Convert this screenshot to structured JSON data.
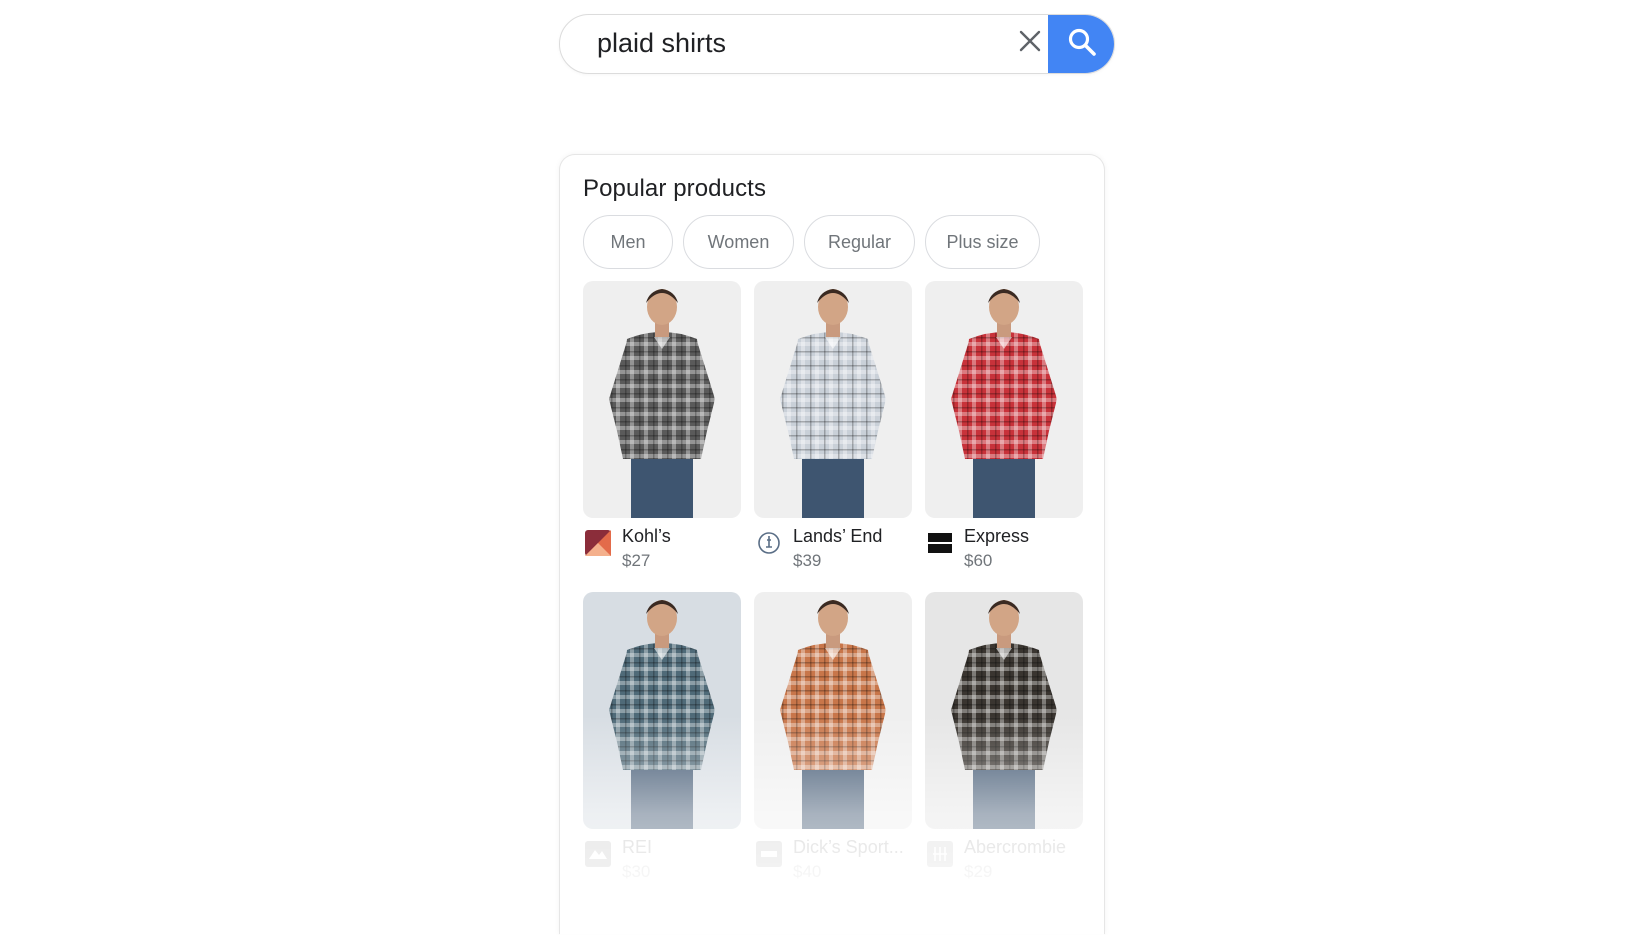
{
  "search": {
    "query": "plaid shirts"
  },
  "popular": {
    "title": "Popular products",
    "filters": [
      "Men",
      "Women",
      "Regular",
      "Plus size"
    ],
    "products": [
      {
        "merchant": "Kohl’s",
        "price": "$27",
        "logo": "kohls-logo-icon",
        "shirt": "#5a5a5a",
        "bg": "#efefef"
      },
      {
        "merchant": "Lands’ End",
        "price": "$39",
        "logo": "lands-end-logo-icon",
        "shirt": "#c9d0d8",
        "bg": "#efefef"
      },
      {
        "merchant": "Express",
        "price": "$60",
        "logo": "express-logo-icon",
        "shirt": "#c8323a",
        "bg": "#efefef"
      },
      {
        "merchant": "REI",
        "price": "$30",
        "logo": "rei-logo-icon",
        "shirt": "#4f6a78",
        "bg": "#d7dde3"
      },
      {
        "merchant": "Dick’s Sport...",
        "price": "$40",
        "logo": "dicks-logo-icon",
        "shirt": "#c8764a",
        "bg": "#efefef"
      },
      {
        "merchant": "Abercrombie",
        "price": "$29",
        "logo": "abercrombie-logo-icon",
        "shirt": "#3a3530",
        "bg": "#e6e6e6"
      }
    ]
  },
  "colors": {
    "accent": "#4285f4",
    "text": "#202124",
    "muted": "#70757a"
  }
}
